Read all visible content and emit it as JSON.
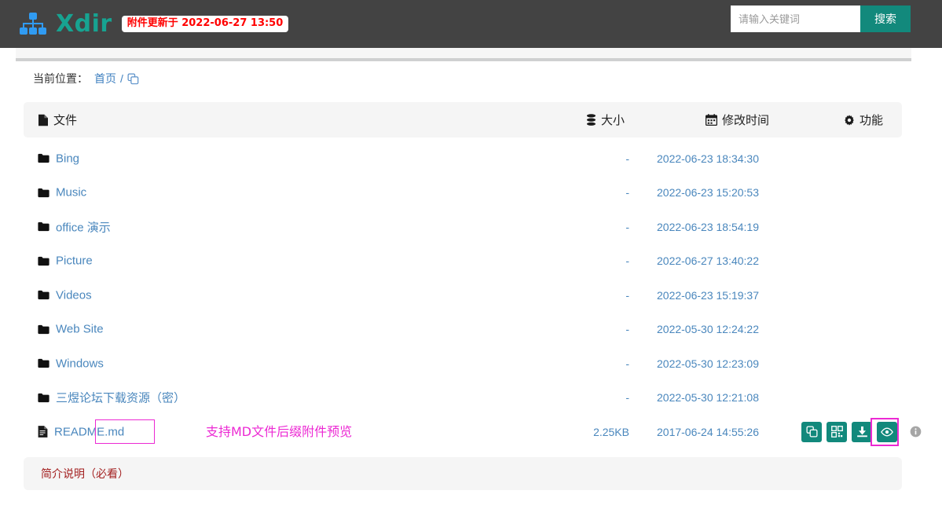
{
  "header": {
    "logo_icon": "sitemap-icon",
    "brand": "Xdir",
    "brand_color": "#17a391",
    "update_badge": "附件更新于 2022-06-27 13:50",
    "badge_text_color": "#ff0000",
    "bar_color": "#434343"
  },
  "search": {
    "placeholder": "请输入关键词",
    "value": "",
    "button_label": "搜索",
    "button_color": "#12897c"
  },
  "breadcrumb": {
    "label": "当前位置：",
    "home": "首页",
    "separator": "/",
    "copy_icon": "copy-icon"
  },
  "table": {
    "columns": [
      {
        "key": "file",
        "label": "文件",
        "icon": "file-icon"
      },
      {
        "key": "size",
        "label": "大小",
        "icon": "database-icon"
      },
      {
        "key": "mtime",
        "label": "修改时间",
        "icon": "calendar-icon"
      },
      {
        "key": "func",
        "label": "功能",
        "icon": "gear-icon"
      }
    ],
    "rows": [
      {
        "name": "Bing",
        "type": "folder",
        "icon": "folder-icon",
        "size": "-",
        "mtime": "2022-06-23 18:34:30"
      },
      {
        "name": "Music",
        "type": "folder",
        "icon": "folder-icon",
        "size": "-",
        "mtime": "2022-06-23 15:20:53"
      },
      {
        "name": "office 演示",
        "type": "folder",
        "icon": "folder-icon",
        "size": "-",
        "mtime": "2022-06-23 18:54:19"
      },
      {
        "name": "Picture",
        "type": "folder",
        "icon": "folder-icon",
        "size": "-",
        "mtime": "2022-06-27 13:40:22"
      },
      {
        "name": "Videos",
        "type": "folder",
        "icon": "folder-icon",
        "size": "-",
        "mtime": "2022-06-23 15:19:37"
      },
      {
        "name": "Web Site",
        "type": "folder",
        "icon": "folder-icon",
        "size": "-",
        "mtime": "2022-05-30 12:24:22"
      },
      {
        "name": "Windows",
        "type": "folder",
        "icon": "folder-icon",
        "size": "-",
        "mtime": "2022-05-30 12:23:09"
      },
      {
        "name": "三煜论坛下载资源（密）",
        "type": "folder",
        "icon": "folder-icon",
        "size": "-",
        "mtime": "2022-05-30 12:21:08"
      },
      {
        "name": "README.md",
        "type": "file",
        "icon": "file-text-icon",
        "size": "2.25KB",
        "mtime": "2017-06-24 14:55:26"
      }
    ],
    "link_color": "#4a87bd"
  },
  "row_actions": {
    "buttons": [
      {
        "name": "copy-link-button",
        "icon": "copy-icon"
      },
      {
        "name": "qrcode-button",
        "icon": "qrcode-icon"
      },
      {
        "name": "download-button",
        "icon": "download-icon"
      },
      {
        "name": "preview-button",
        "icon": "eye-icon"
      }
    ],
    "info_icon": "info-circle-icon",
    "button_color": "#12897c"
  },
  "annotation": {
    "text": "支持MD文件后缀附件预览",
    "color": "#ec29d3"
  },
  "note": {
    "text": "简介说明（必看）",
    "color": "#a32020"
  }
}
